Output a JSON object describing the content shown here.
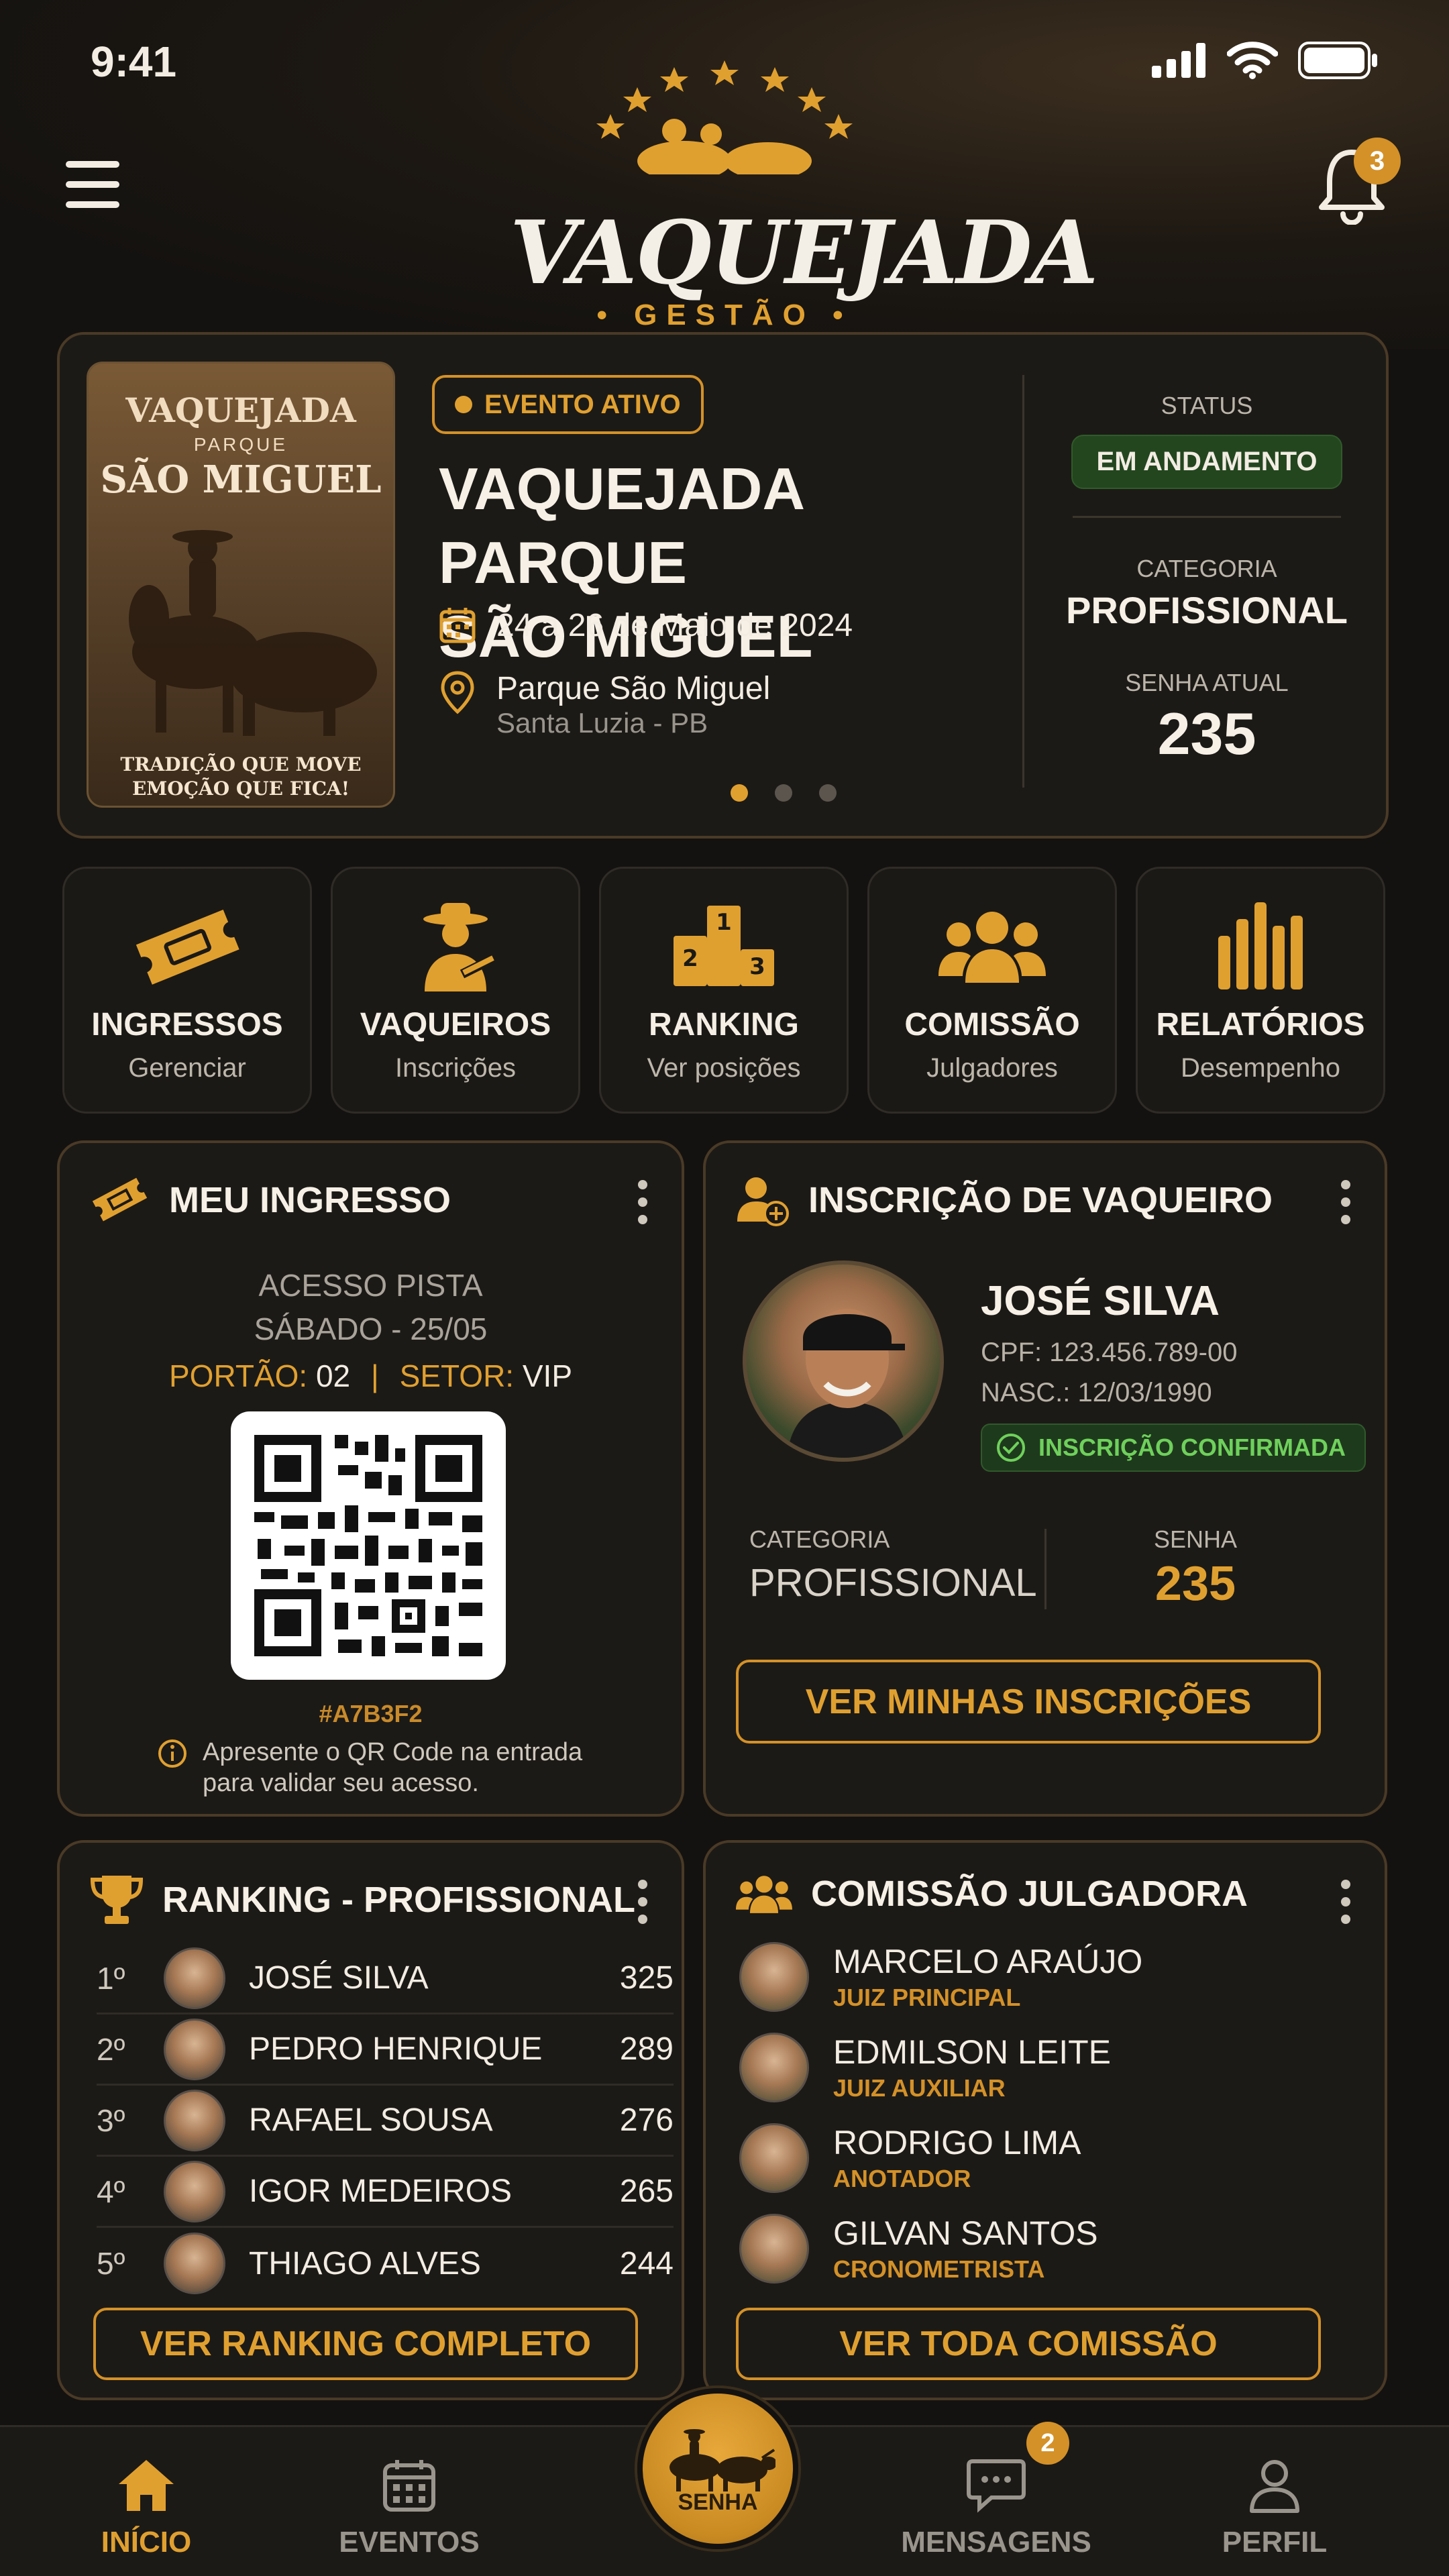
{
  "status_bar": {
    "time": "9:41"
  },
  "header": {
    "logo_title": "VAQUEJADA",
    "logo_subtitle": "• GESTÃO •",
    "notifications_count": "3"
  },
  "event": {
    "poster_line1": "VAQUEJADA",
    "poster_line2": "PARQUE",
    "poster_line3": "SÃO MIGUEL",
    "poster_footer_1": "TRADIÇÃO QUE MOVE",
    "poster_footer_2": "EMOÇÃO QUE FICA!",
    "badge": "EVENTO ATIVO",
    "title_line1": "VAQUEJADA PARQUE",
    "title_line2": "SÃO MIGUEL",
    "dates": "24 a 26 de Maio de 2024",
    "venue": "Parque São Miguel",
    "city": "Santa Luzia - PB",
    "status_label": "STATUS",
    "status_value": "EM ANDAMENTO",
    "category_label": "CATEGORIA",
    "category_value": "PROFISSIONAL",
    "password_label": "SENHA ATUAL",
    "password_value": "235",
    "carousel_active": 1,
    "carousel_total": 3
  },
  "quick_actions": [
    {
      "title": "INGRESSOS",
      "subtitle": "Gerenciar",
      "icon": "ticket-icon"
    },
    {
      "title": "VAQUEIROS",
      "subtitle": "Inscrições",
      "icon": "cowboy-icon"
    },
    {
      "title": "RANKING",
      "subtitle": "Ver posições",
      "icon": "podium-icon"
    },
    {
      "title": "COMISSÃO",
      "subtitle": "Julgadores",
      "icon": "group-icon"
    },
    {
      "title": "RELATÓRIOS",
      "subtitle": "Desempenho",
      "icon": "bar-chart-icon"
    }
  ],
  "ticket": {
    "title": "MEU INGRESSO",
    "access": "ACESSO PISTA",
    "day": "SÁBADO - 25/05",
    "gate_label": "PORTÃO:",
    "gate_value": "02",
    "separator": "|",
    "sector_label": "SETOR:",
    "sector_value": "VIP",
    "code": "#A7B3F2",
    "info_line1": "Apresente o QR Code na entrada",
    "info_line2": "para validar seu acesso."
  },
  "registration": {
    "title": "INSCRIÇÃO DE VAQUEIRO",
    "name": "JOSÉ SILVA",
    "cpf": "CPF: 123.456.789-00",
    "birth": "NASC.: 12/03/1990",
    "status": "INSCRIÇÃO CONFIRMADA",
    "category_label": "CATEGORIA",
    "category_value": "PROFISSIONAL",
    "password_label": "SENHA",
    "password_value": "235",
    "button": "VER MINHAS INSCRIÇÕES"
  },
  "ranking": {
    "title": "RANKING - PROFISSIONAL",
    "rows": [
      {
        "pos": "1º",
        "name": "JOSÉ SILVA",
        "points": "325"
      },
      {
        "pos": "2º",
        "name": "PEDRO HENRIQUE",
        "points": "289"
      },
      {
        "pos": "3º",
        "name": "RAFAEL SOUSA",
        "points": "276"
      },
      {
        "pos": "4º",
        "name": "IGOR MEDEIROS",
        "points": "265"
      },
      {
        "pos": "5º",
        "name": "THIAGO ALVES",
        "points": "244"
      }
    ],
    "button": "VER RANKING COMPLETO"
  },
  "commission": {
    "title": "COMISSÃO JULGADORA",
    "members": [
      {
        "name": "MARCELO ARAÚJO",
        "role": "JUIZ PRINCIPAL"
      },
      {
        "name": "EDMILSON LEITE",
        "role": "JUIZ AUXILIAR"
      },
      {
        "name": "RODRIGO LIMA",
        "role": "ANOTADOR"
      },
      {
        "name": "GILVAN SANTOS",
        "role": "CRONOMETRISTA"
      }
    ],
    "button": "VER TODA COMISSÃO"
  },
  "bottom_nav": {
    "home": "INÍCIO",
    "events": "EVENTOS",
    "center": "SENHA",
    "messages": "MENSAGENS",
    "messages_badge": "2",
    "profile": "PERFIL"
  },
  "colors": {
    "accent": "#e0a030",
    "background": "#141210",
    "card": "#1c1a17",
    "success": "#6fd05c"
  }
}
